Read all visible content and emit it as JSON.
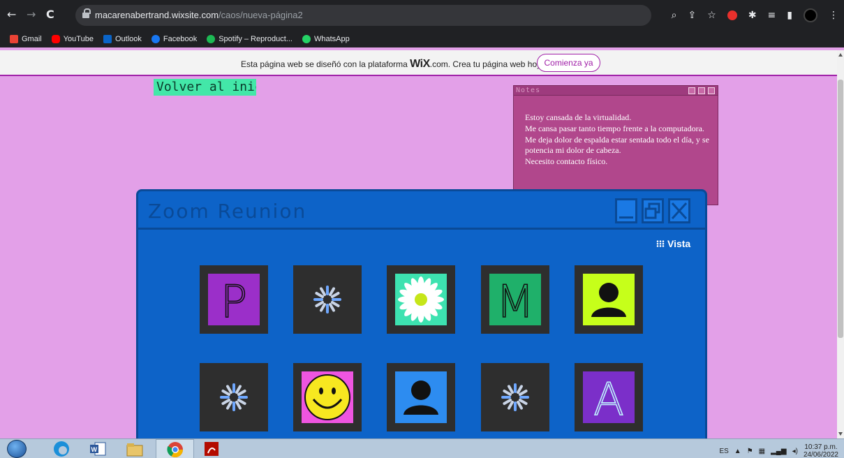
{
  "browser": {
    "url_domain": "macarenabertrand.wixsite.com",
    "url_path": "/caos/nueva-página2",
    "bookmarks": [
      {
        "label": "Gmail",
        "color": "#ea4335"
      },
      {
        "label": "YouTube",
        "color": "#ff0000"
      },
      {
        "label": "Outlook",
        "color": "#0a64c8"
      },
      {
        "label": "Facebook",
        "color": "#1877f2"
      },
      {
        "label": "Spotify – Reproduct...",
        "color": "#1db954"
      },
      {
        "label": "WhatsApp",
        "color": "#25d366"
      }
    ]
  },
  "wix": {
    "message_before": "Esta página web se diseñó con la plataforma ",
    "logo": "WiX",
    "message_after": ".com. Crea tu página web hoy.",
    "cta": "Comienza ya"
  },
  "page": {
    "back_link": "Volver al inicio"
  },
  "notes": {
    "title": "Notes",
    "body": "Estoy cansada de la virtualidad.\nMe cansa pasar tanto tiempo frente a la computadora.\nMe deja dolor de espalda estar sentada todo el día, y se potencia mi dolor de cabeza.\nNecesito contacto físico."
  },
  "zoom": {
    "title": "Zoom Reunion",
    "vista_label": "Vista",
    "participants": [
      {
        "kind": "letter",
        "letter": "P",
        "bg": "#9b2fc9",
        "fg": "#111111"
      },
      {
        "kind": "loading"
      },
      {
        "kind": "flower",
        "bg": "#3de2b0"
      },
      {
        "kind": "letter",
        "letter": "M",
        "bg": "#1fb06a",
        "fg": "#111111"
      },
      {
        "kind": "avatar",
        "bg": "#c6ff1a"
      },
      {
        "kind": "loading"
      },
      {
        "kind": "smiley",
        "bg": "#ee55e0"
      },
      {
        "kind": "avatar",
        "bg": "#2d8cf0"
      },
      {
        "kind": "loading"
      },
      {
        "kind": "letter",
        "letter": "A",
        "bg": "#7b2fc9",
        "fg": "#bff5ff"
      }
    ]
  },
  "taskbar": {
    "lang": "ES",
    "time": "10:37 p.m.",
    "date": "24/06/2022"
  }
}
